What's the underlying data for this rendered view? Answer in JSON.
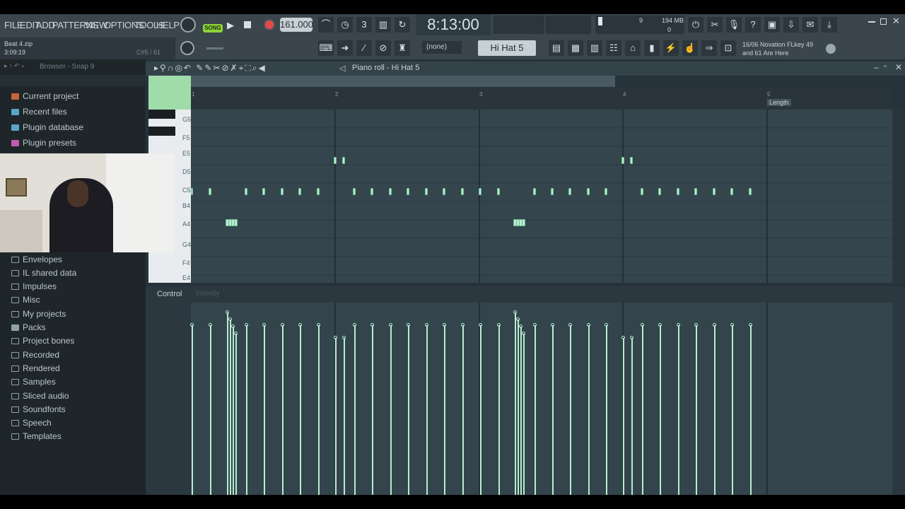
{
  "menu": [
    "FILE",
    "EDIT",
    "ADD",
    "PATTERNS",
    "VIEW",
    "OPTIONS",
    "TOOLS",
    "HELP"
  ],
  "transport": {
    "mode": "SONG",
    "tempo": "161.000",
    "time": "8:13:00",
    "memory": "194 MB",
    "cpu_val": "9",
    "cpu_zero": "0"
  },
  "project": {
    "file": "Beat 4.zip",
    "elapsed": "3:09:19",
    "key_hint": "C#5 / 61"
  },
  "toolbar2": {
    "snap_select": "(none)",
    "pattern": "Hi Hat 5",
    "hint_line1": "16/06  Novation FLkey 49",
    "hint_line2": "and 61 Are Here"
  },
  "browser": {
    "header": "Browser - Snap 9",
    "items_top": [
      "Current project",
      "Recent files",
      "Plugin database",
      "Plugin presets"
    ],
    "items_bottom": [
      "Envelopes",
      "IL shared data",
      "Impulses",
      "Misc",
      "My projects",
      "Packs",
      "Project bones",
      "Recorded",
      "Rendered",
      "Samples",
      "Sliced audio",
      "Soundfonts",
      "Speech",
      "Templates"
    ]
  },
  "pianoroll": {
    "title": "Piano roll - Hi Hat 5",
    "bars": [
      "1",
      "2",
      "3",
      "4",
      "5"
    ],
    "length_label": "Length",
    "keys": [
      "G5",
      "F5",
      "E5",
      "D5",
      "C5",
      "B4",
      "A4",
      "G4",
      "F4",
      "E4"
    ],
    "control_label": "Control",
    "control_value": "Velocity"
  },
  "colors": {
    "note": "#b6eed0",
    "toolbar": "#3a454c",
    "grid": "#34454e",
    "browser": "#1f262a",
    "accent_song": "#8fd43a",
    "record": "#e24a4a"
  },
  "notes": {
    "c5_ticks": [
      0.25,
      0.5,
      0.75,
      1.0,
      1.25,
      1.5,
      2.0,
      2.25,
      2.5,
      2.75,
      3.0,
      3.25,
      3.5,
      3.75,
      4.0,
      4.25,
      4.75,
      5.0,
      5.25,
      5.5,
      5.75,
      6.25,
      6.5,
      6.75,
      7.0,
      7.25,
      7.5,
      7.75
    ]
  }
}
